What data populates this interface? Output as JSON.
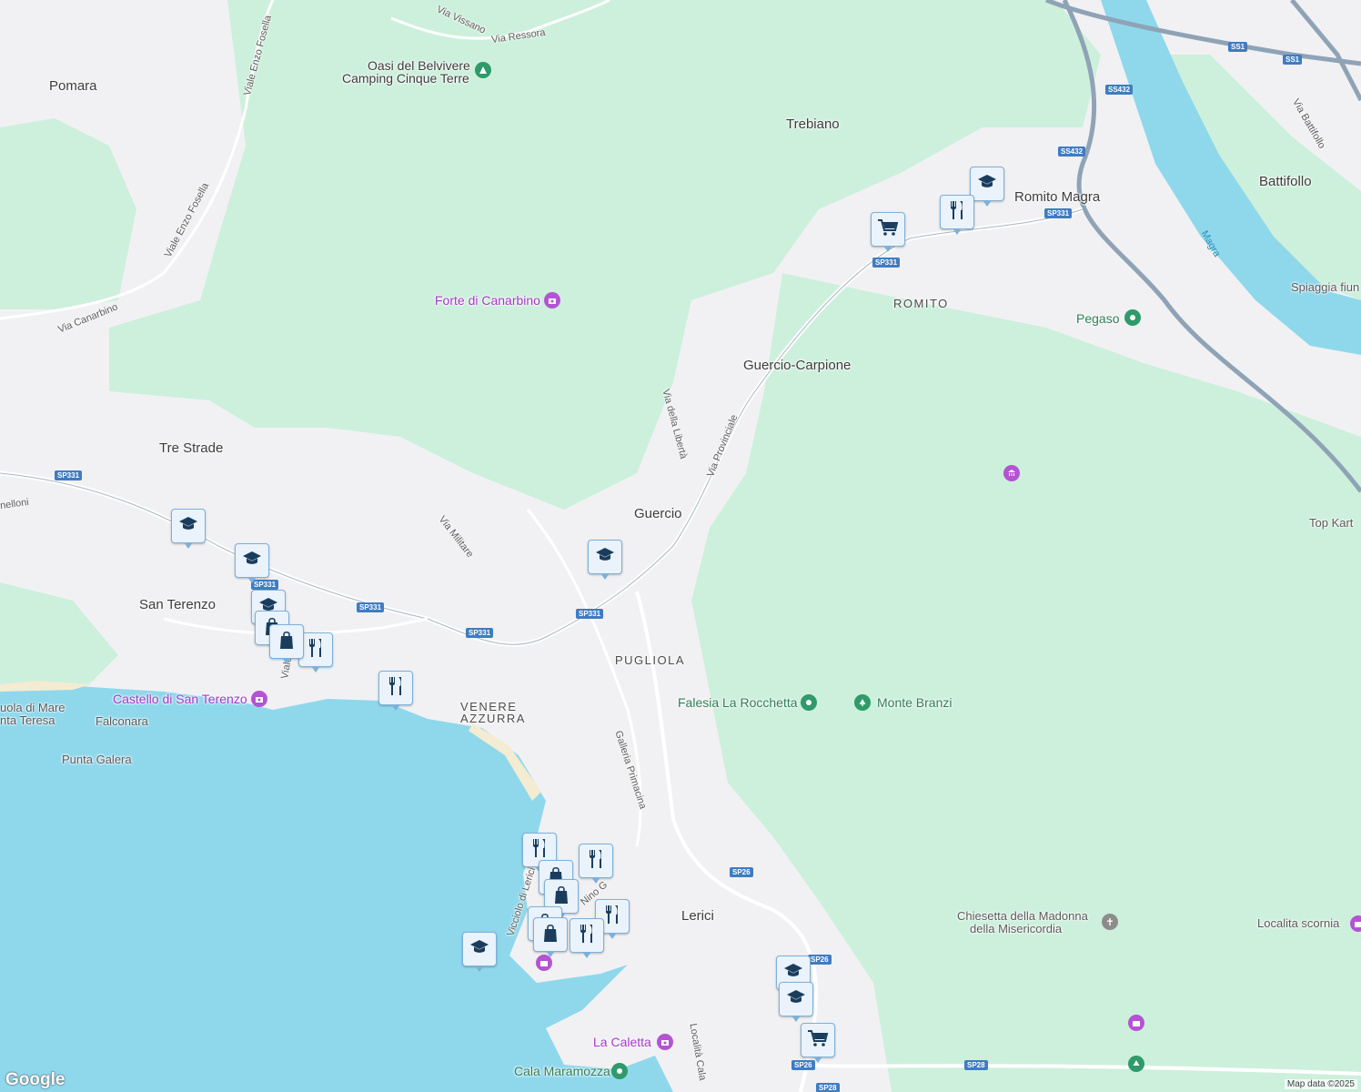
{
  "labels": {
    "pomara": "Pomara",
    "trebiano": "Trebiano",
    "romito_magra": "Romito Magra",
    "battifollo": "Battifollo",
    "romito": "ROMITO",
    "guercio_carpione": "Guercio-Carpione",
    "tre_strade": "Tre Strade",
    "guercio": "Guercio",
    "san_terenzo": "San Terenzo",
    "pugliola": "PUGLIOLA",
    "venere_azzurra_1": "VENERE",
    "venere_azzurra_2": "AZZURRA",
    "lerici": "Lerici",
    "falconara": "Falconara",
    "punta_galera": "Punta Galera",
    "scuola_1": "uola di Mare",
    "scuola_2": "nta Teresa",
    "top_kart": "Top Kart",
    "localita_scornia": "Localita scornia",
    "spiaggia": "Spiaggia fiun",
    "cala_maramozza": "Cala Maramozza"
  },
  "streets": {
    "via_vissano": "Via Vissano",
    "via_ressora": "Via Ressora",
    "viale_enzo_fosella_top": "Viale Enzo Fosella",
    "viale_enzo_fosella_mid": "Viale Enzo Fosella",
    "via_canarbino": "Via Canarbino",
    "via_della_liberta": "Via della Libertà",
    "via_provinciale": "Via Provinciale",
    "via_militare": "Via Militare",
    "galleria_primacina": "Galleria Primacina",
    "via_battifollo": "Via Battifollo",
    "localita_cala": "Località Cala",
    "nino_gr": "Nino G",
    "vicciolo": "Vicciolo di Lerici",
    "melloni": "nelloni",
    "viale_partial": "Viale"
  },
  "pois": {
    "oasi_1": "Oasi del Belvivere",
    "oasi_2": "Camping Cinque Terre",
    "forte": "Forte di Canarbino",
    "castello": "Castello di San Terenzo",
    "falesia": "Falesia La Rocchetta",
    "monte_branzi": "Monte Branzi",
    "pegaso": "Pegaso",
    "chiesetta_1": "Chiesetta della Madonna",
    "chiesetta_2": "della Misericordia",
    "la_caletta": "La Caletta"
  },
  "water": {
    "magra": "Magra"
  },
  "shields": [
    "SS1",
    "SS1",
    "SS432",
    "SS432",
    "SP331",
    "SP331",
    "SP331",
    "SP331",
    "SP331",
    "SP331",
    "SP331",
    "SP26",
    "SP26",
    "SP26",
    "SP28",
    "SP28"
  ],
  "attribution": "Map data ©2025",
  "logo": "Google",
  "colors": {
    "land": "#f1f1f3",
    "forest": "#cdf0dc",
    "water": "#8fd8ec",
    "highway": "#8fa3b6",
    "shield": "#3f7cc2",
    "poi_purple": "#a436c9",
    "poi_green": "#2f7d55",
    "pin_fill": "#eaf3fb",
    "pin_icon": "#1a3d5e"
  },
  "markers": {
    "school": "graduation-cap-icon",
    "restaurant": "fork-knife-icon",
    "shopping": "shopping-bag-icon",
    "grocery": "shopping-cart-icon"
  }
}
